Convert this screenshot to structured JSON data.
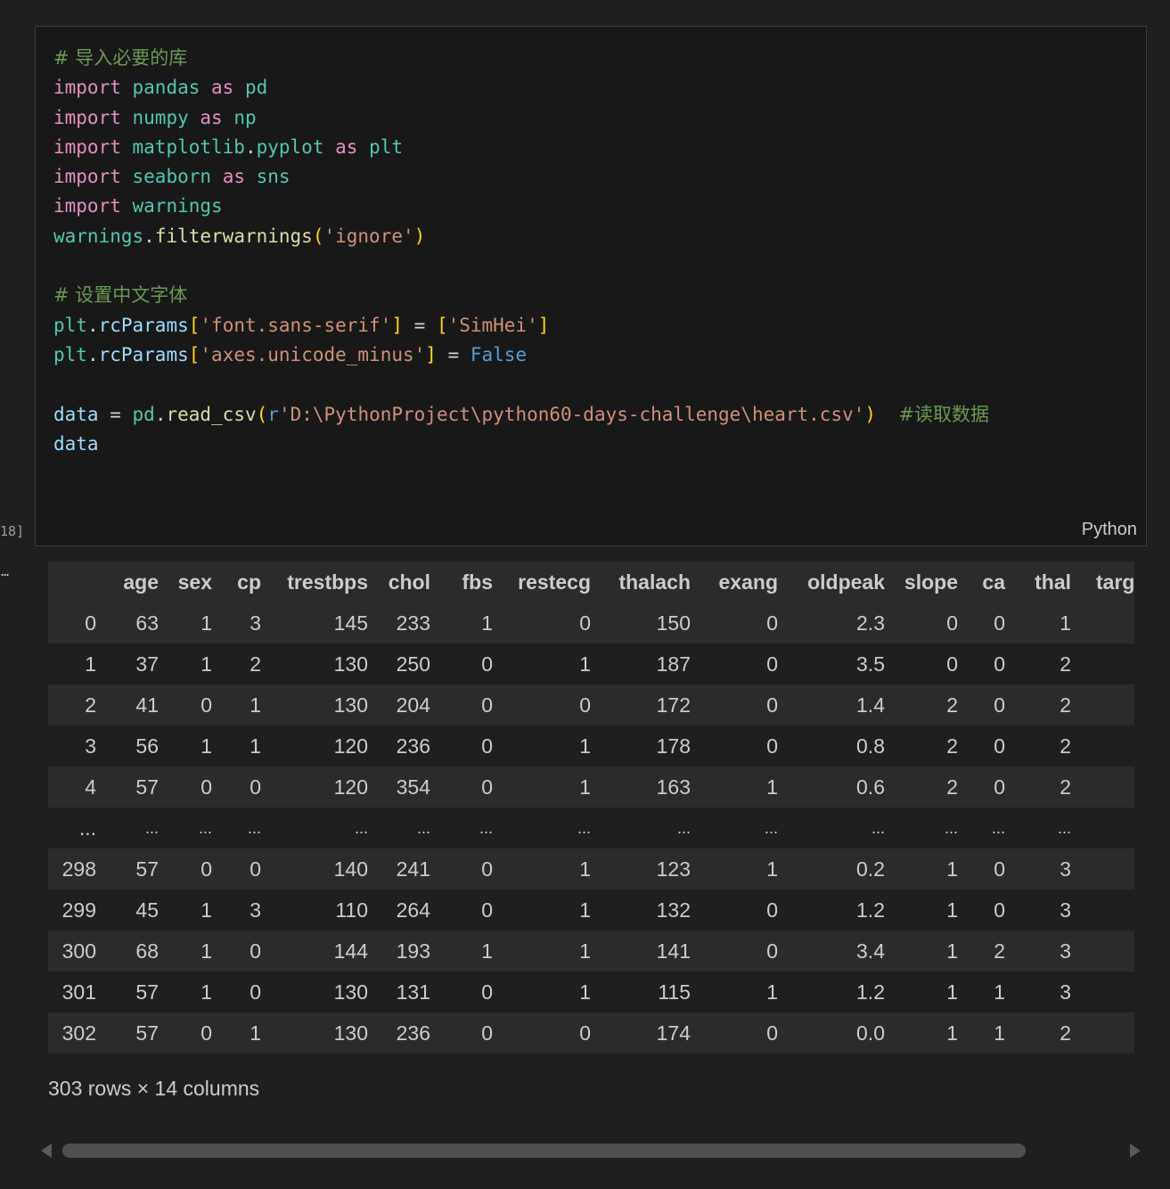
{
  "cell": {
    "execution_count": "18]",
    "language": "Python",
    "output_indicator": "..."
  },
  "code_lines": [
    [
      {
        "t": "# 导入必要的库",
        "c": "cmt"
      }
    ],
    [
      {
        "t": "import",
        "c": "kw"
      },
      {
        "t": " "
      },
      {
        "t": "pandas",
        "c": "mod"
      },
      {
        "t": " "
      },
      {
        "t": "as",
        "c": "kw"
      },
      {
        "t": " "
      },
      {
        "t": "pd",
        "c": "mod"
      }
    ],
    [
      {
        "t": "import",
        "c": "kw"
      },
      {
        "t": " "
      },
      {
        "t": "numpy",
        "c": "mod"
      },
      {
        "t": " "
      },
      {
        "t": "as",
        "c": "kw"
      },
      {
        "t": " "
      },
      {
        "t": "np",
        "c": "mod"
      }
    ],
    [
      {
        "t": "import",
        "c": "kw"
      },
      {
        "t": " "
      },
      {
        "t": "matplotlib",
        "c": "mod"
      },
      {
        "t": "."
      },
      {
        "t": "pyplot",
        "c": "mod"
      },
      {
        "t": " "
      },
      {
        "t": "as",
        "c": "kw"
      },
      {
        "t": " "
      },
      {
        "t": "plt",
        "c": "mod"
      }
    ],
    [
      {
        "t": "import",
        "c": "kw"
      },
      {
        "t": " "
      },
      {
        "t": "seaborn",
        "c": "mod"
      },
      {
        "t": " "
      },
      {
        "t": "as",
        "c": "kw"
      },
      {
        "t": " "
      },
      {
        "t": "sns",
        "c": "mod"
      }
    ],
    [
      {
        "t": "import",
        "c": "kw"
      },
      {
        "t": " "
      },
      {
        "t": "warnings",
        "c": "mod"
      }
    ],
    [
      {
        "t": "warnings",
        "c": "mod"
      },
      {
        "t": "."
      },
      {
        "t": "filterwarnings",
        "c": "fn"
      },
      {
        "t": "(",
        "c": "br1"
      },
      {
        "t": "'ignore'",
        "c": "str"
      },
      {
        "t": ")",
        "c": "br1"
      }
    ],
    [],
    [
      {
        "t": "# 设置中文字体",
        "c": "cmt"
      }
    ],
    [
      {
        "t": "plt",
        "c": "mod"
      },
      {
        "t": "."
      },
      {
        "t": "rcParams",
        "c": "var"
      },
      {
        "t": "[",
        "c": "br1"
      },
      {
        "t": "'font.sans-serif'",
        "c": "str"
      },
      {
        "t": "]",
        "c": "br1"
      },
      {
        "t": " = "
      },
      {
        "t": "[",
        "c": "br1"
      },
      {
        "t": "'SimHei'",
        "c": "str"
      },
      {
        "t": "]",
        "c": "br1"
      }
    ],
    [
      {
        "t": "plt",
        "c": "mod"
      },
      {
        "t": "."
      },
      {
        "t": "rcParams",
        "c": "var"
      },
      {
        "t": "[",
        "c": "br1"
      },
      {
        "t": "'axes.unicode_minus'",
        "c": "str"
      },
      {
        "t": "]",
        "c": "br1"
      },
      {
        "t": " = "
      },
      {
        "t": "False",
        "c": "const"
      }
    ],
    [],
    [
      {
        "t": "data",
        "c": "var"
      },
      {
        "t": " = "
      },
      {
        "t": "pd",
        "c": "mod"
      },
      {
        "t": "."
      },
      {
        "t": "read_csv",
        "c": "fn"
      },
      {
        "t": "(",
        "c": "br1"
      },
      {
        "t": "r",
        "c": "const"
      },
      {
        "t": "'D:\\PythonProject\\python60-days-challenge\\heart.csv'",
        "c": "str"
      },
      {
        "t": ")",
        "c": "br1"
      },
      {
        "t": "  "
      },
      {
        "t": "#读取数据",
        "c": "cmt"
      }
    ],
    [
      {
        "t": "data",
        "c": "var"
      }
    ]
  ],
  "table": {
    "columns": [
      "",
      "age",
      "sex",
      "cp",
      "trestbps",
      "chol",
      "fbs",
      "restecg",
      "thalach",
      "exang",
      "oldpeak",
      "slope",
      "ca",
      "thal",
      "targ"
    ],
    "rows": [
      [
        "0",
        "63",
        "1",
        "3",
        "145",
        "233",
        "1",
        "0",
        "150",
        "0",
        "2.3",
        "0",
        "0",
        "1",
        ""
      ],
      [
        "1",
        "37",
        "1",
        "2",
        "130",
        "250",
        "0",
        "1",
        "187",
        "0",
        "3.5",
        "0",
        "0",
        "2",
        ""
      ],
      [
        "2",
        "41",
        "0",
        "1",
        "130",
        "204",
        "0",
        "0",
        "172",
        "0",
        "1.4",
        "2",
        "0",
        "2",
        ""
      ],
      [
        "3",
        "56",
        "1",
        "1",
        "120",
        "236",
        "0",
        "1",
        "178",
        "0",
        "0.8",
        "2",
        "0",
        "2",
        ""
      ],
      [
        "4",
        "57",
        "0",
        "0",
        "120",
        "354",
        "0",
        "1",
        "163",
        "1",
        "0.6",
        "2",
        "0",
        "2",
        ""
      ],
      [
        "...",
        "...",
        "...",
        "...",
        "...",
        "...",
        "...",
        "...",
        "...",
        "...",
        "...",
        "...",
        "...",
        "...",
        ""
      ],
      [
        "298",
        "57",
        "0",
        "0",
        "140",
        "241",
        "0",
        "1",
        "123",
        "1",
        "0.2",
        "1",
        "0",
        "3",
        ""
      ],
      [
        "299",
        "45",
        "1",
        "3",
        "110",
        "264",
        "0",
        "1",
        "132",
        "0",
        "1.2",
        "1",
        "0",
        "3",
        ""
      ],
      [
        "300",
        "68",
        "1",
        "0",
        "144",
        "193",
        "1",
        "1",
        "141",
        "0",
        "3.4",
        "1",
        "2",
        "3",
        ""
      ],
      [
        "301",
        "57",
        "1",
        "0",
        "130",
        "131",
        "0",
        "1",
        "115",
        "1",
        "1.2",
        "1",
        "1",
        "3",
        ""
      ],
      [
        "302",
        "57",
        "0",
        "1",
        "130",
        "236",
        "0",
        "0",
        "174",
        "0",
        "0.0",
        "1",
        "1",
        "2",
        ""
      ]
    ],
    "shape_text": "303 rows × 14 columns"
  },
  "scrollbar": {
    "position": 0.0,
    "visible_fraction": 0.94
  }
}
